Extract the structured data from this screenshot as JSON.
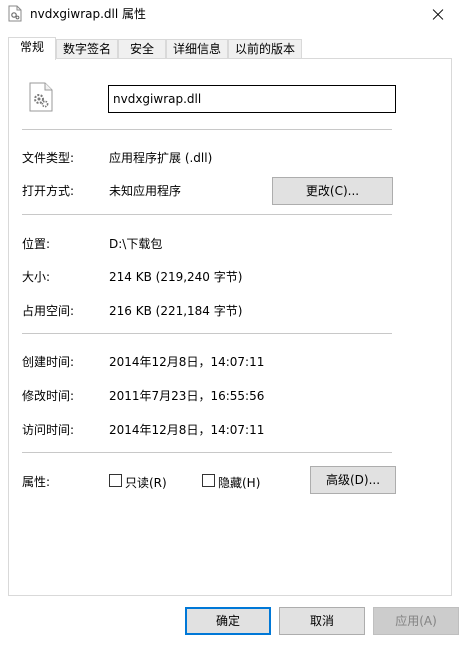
{
  "window": {
    "title": "nvdxgiwrap.dll 属性"
  },
  "tabs": [
    {
      "label": "常规",
      "active": true
    },
    {
      "label": "数字签名",
      "active": false
    },
    {
      "label": "安全",
      "active": false
    },
    {
      "label": "详细信息",
      "active": false
    },
    {
      "label": "以前的版本",
      "active": false
    }
  ],
  "general": {
    "file_name": "nvdxgiwrap.dll",
    "file_type_label": "文件类型:",
    "file_type_value": "应用程序扩展 (.dll)",
    "open_with_label": "打开方式:",
    "open_with_value": "未知应用程序",
    "change_button": "更改(C)...",
    "location_label": "位置:",
    "location_value": "D:\\下载包",
    "size_label": "大小:",
    "size_value": "214 KB (219,240 字节)",
    "size_on_disk_label": "占用空间:",
    "size_on_disk_value": "216 KB (221,184 字节)",
    "created_label": "创建时间:",
    "created_value": "2014年12月8日，14:07:11",
    "modified_label": "修改时间:",
    "modified_value": "2011年7月23日，16:55:56",
    "accessed_label": "访问时间:",
    "accessed_value": "2014年12月8日，14:07:11",
    "attributes_label": "属性:",
    "readonly_label": "只读(R)",
    "hidden_label": "隐藏(H)",
    "advanced_button": "高级(D)..."
  },
  "footer": {
    "ok": "确定",
    "cancel": "取消",
    "apply": "应用(A)"
  },
  "colors": {
    "accent": "#0078d7",
    "button_bg": "#e1e1e1",
    "separator": "#c8c8c8"
  },
  "icons": {
    "title": "dll-file-icon",
    "file": "dll-gear-file-icon",
    "close": "close-icon"
  }
}
